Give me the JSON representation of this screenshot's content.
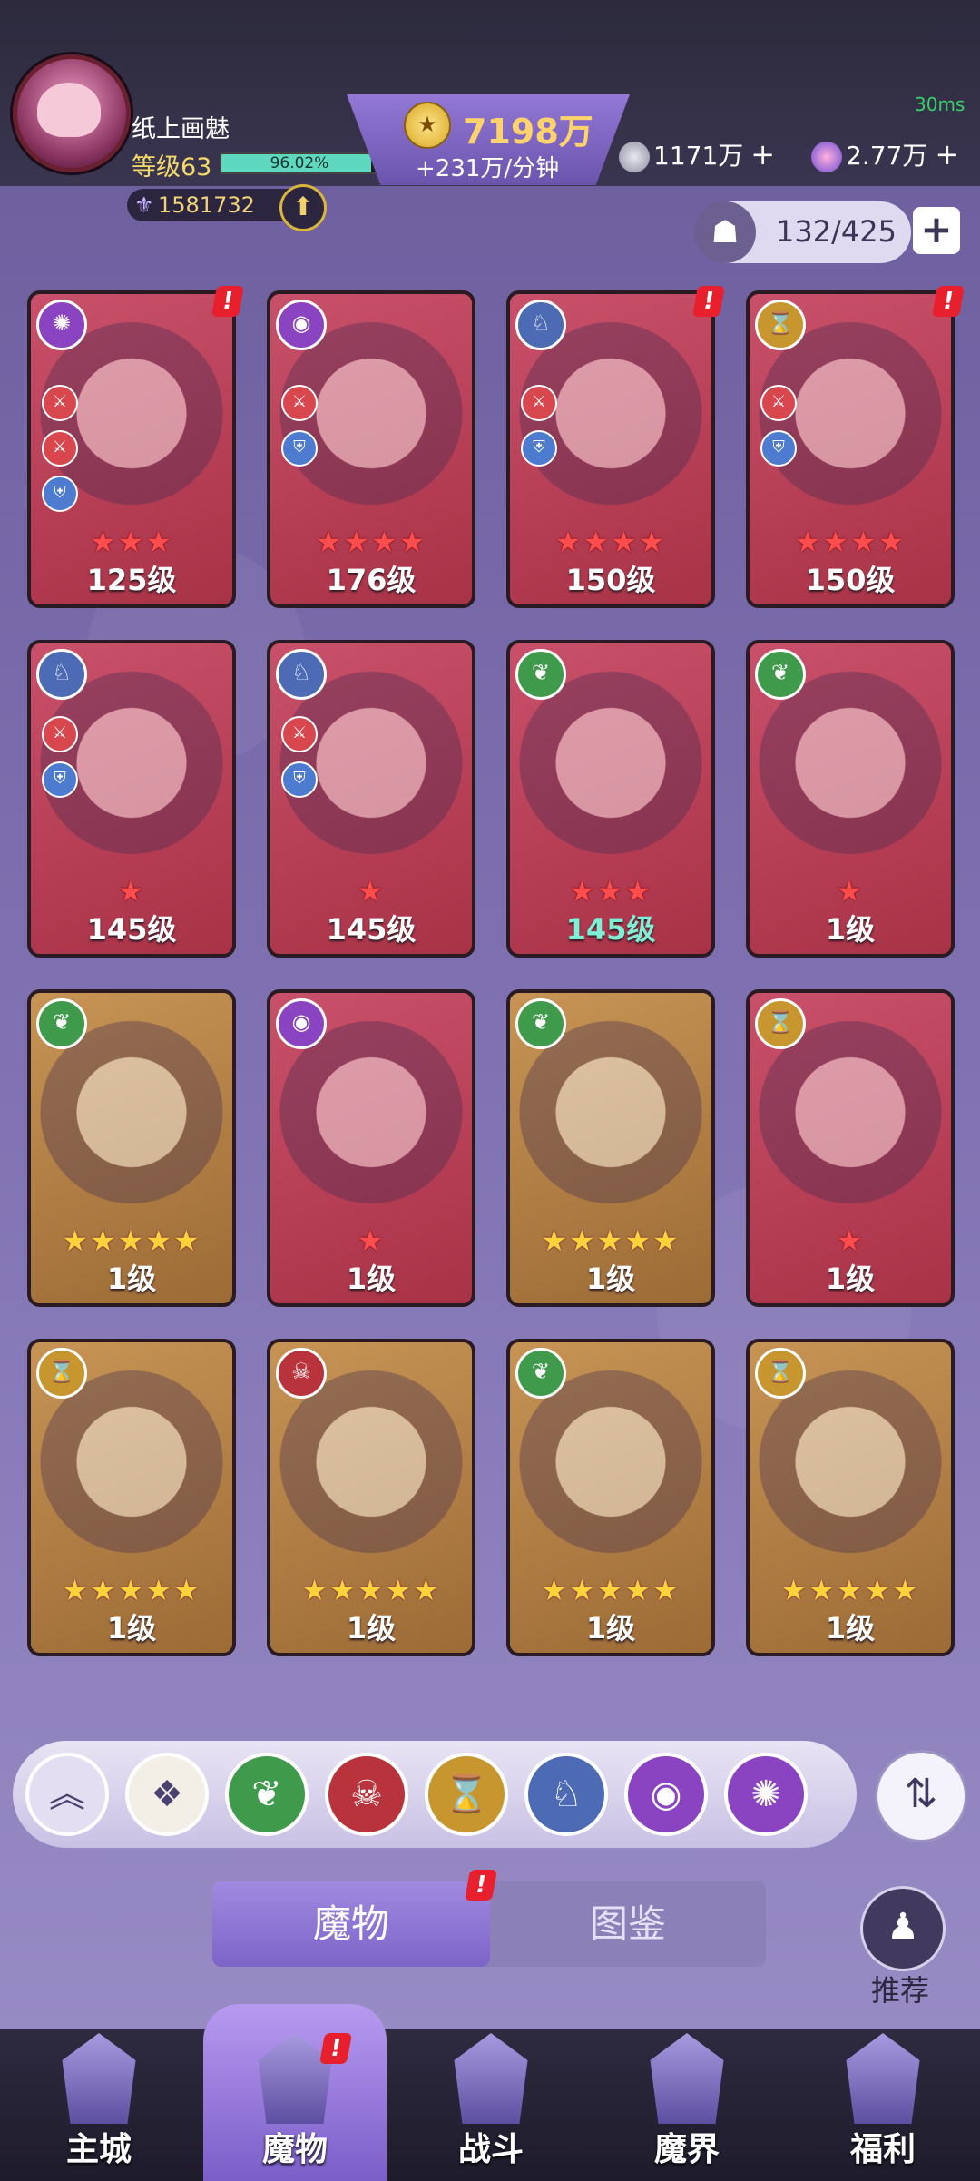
{
  "header": {
    "player_name": "纸上画魅",
    "level_label": "等级63",
    "xp_percent_text": "96.02%",
    "xp_fraction": 0.9602,
    "power": "1581732",
    "gold_amount": "7198万",
    "gold_rate": "+231万/分钟",
    "ping": "30ms",
    "resource_1": "1171万",
    "resource_2": "2.77万",
    "plus_symbol": "+"
  },
  "roster": {
    "count": "132/425",
    "add_symbol": "+"
  },
  "cards": [
    {
      "level": "125级",
      "stars": "★★★",
      "star_color": "red",
      "frame": "red",
      "faction_icon": "spiral-icon"
    },
    {
      "level": "176级",
      "stars": "★★★★",
      "star_color": "red",
      "frame": "red",
      "faction_icon": "eye-icon"
    },
    {
      "level": "150级",
      "stars": "★★★★",
      "star_color": "red",
      "frame": "red",
      "faction_icon": "wolf-icon"
    },
    {
      "level": "150级",
      "stars": "★★★★",
      "star_color": "red",
      "frame": "red",
      "faction_icon": "hourglass-icon"
    },
    {
      "level": "145级",
      "stars": "★",
      "star_color": "red",
      "frame": "red",
      "faction_icon": "wolf-icon"
    },
    {
      "level": "145级",
      "stars": "★",
      "star_color": "red",
      "frame": "red",
      "faction_icon": "wolf-icon"
    },
    {
      "level": "145级",
      "stars": "★★★",
      "star_color": "red",
      "frame": "red",
      "faction_icon": "leaf-icon"
    },
    {
      "level": "1级",
      "stars": "★",
      "star_color": "red",
      "frame": "red",
      "faction_icon": "leaf-icon"
    },
    {
      "level": "1级",
      "stars": "★★★★★",
      "star_color": "gold",
      "frame": "gold",
      "faction_icon": "leaf-icon"
    },
    {
      "level": "1级",
      "stars": "★",
      "star_color": "red",
      "frame": "red",
      "faction_icon": "eye-icon"
    },
    {
      "level": "1级",
      "stars": "★★★★★",
      "star_color": "gold",
      "frame": "gold",
      "faction_icon": "leaf-icon"
    },
    {
      "level": "1级",
      "stars": "★",
      "star_color": "red",
      "frame": "red",
      "faction_icon": "hourglass-icon"
    },
    {
      "level": "1级",
      "stars": "★★★★★",
      "star_color": "gold",
      "frame": "gold",
      "faction_icon": "hourglass-icon"
    },
    {
      "level": "1级",
      "stars": "★★★★★",
      "star_color": "gold",
      "frame": "gold",
      "faction_icon": "demon-icon"
    },
    {
      "level": "1级",
      "stars": "★★★★★",
      "star_color": "gold",
      "frame": "gold",
      "faction_icon": "leaf-icon"
    },
    {
      "level": "1级",
      "stars": "★★★★★",
      "star_color": "gold",
      "frame": "gold",
      "faction_icon": "hourglass-icon"
    }
  ],
  "filters": [
    {
      "icon": "collapse-icon",
      "color": "#e4def2"
    },
    {
      "icon": "all-factions-icon",
      "color": "#f3efe6"
    },
    {
      "icon": "leaf-icon",
      "color": "#3f9a4c"
    },
    {
      "icon": "demon-icon",
      "color": "#b8333c"
    },
    {
      "icon": "hourglass-icon",
      "color": "#c7962e"
    },
    {
      "icon": "wolf-icon",
      "color": "#4d6ab4"
    },
    {
      "icon": "eye-icon",
      "color": "#8a44c2"
    },
    {
      "icon": "spiral-icon",
      "color": "#8a44c2"
    }
  ],
  "tabs": {
    "active": "魔物",
    "other": "图鉴"
  },
  "recommend_label": "推荐",
  "nav": [
    {
      "label": "主城"
    },
    {
      "label": "魔物"
    },
    {
      "label": "战斗"
    },
    {
      "label": "魔界"
    },
    {
      "label": "福利"
    }
  ],
  "colors": {
    "gold": "#ffd36b",
    "level_yellow": "#f5d96b",
    "xp_teal": "#5fd8c0",
    "alert_red": "#e8202e"
  }
}
